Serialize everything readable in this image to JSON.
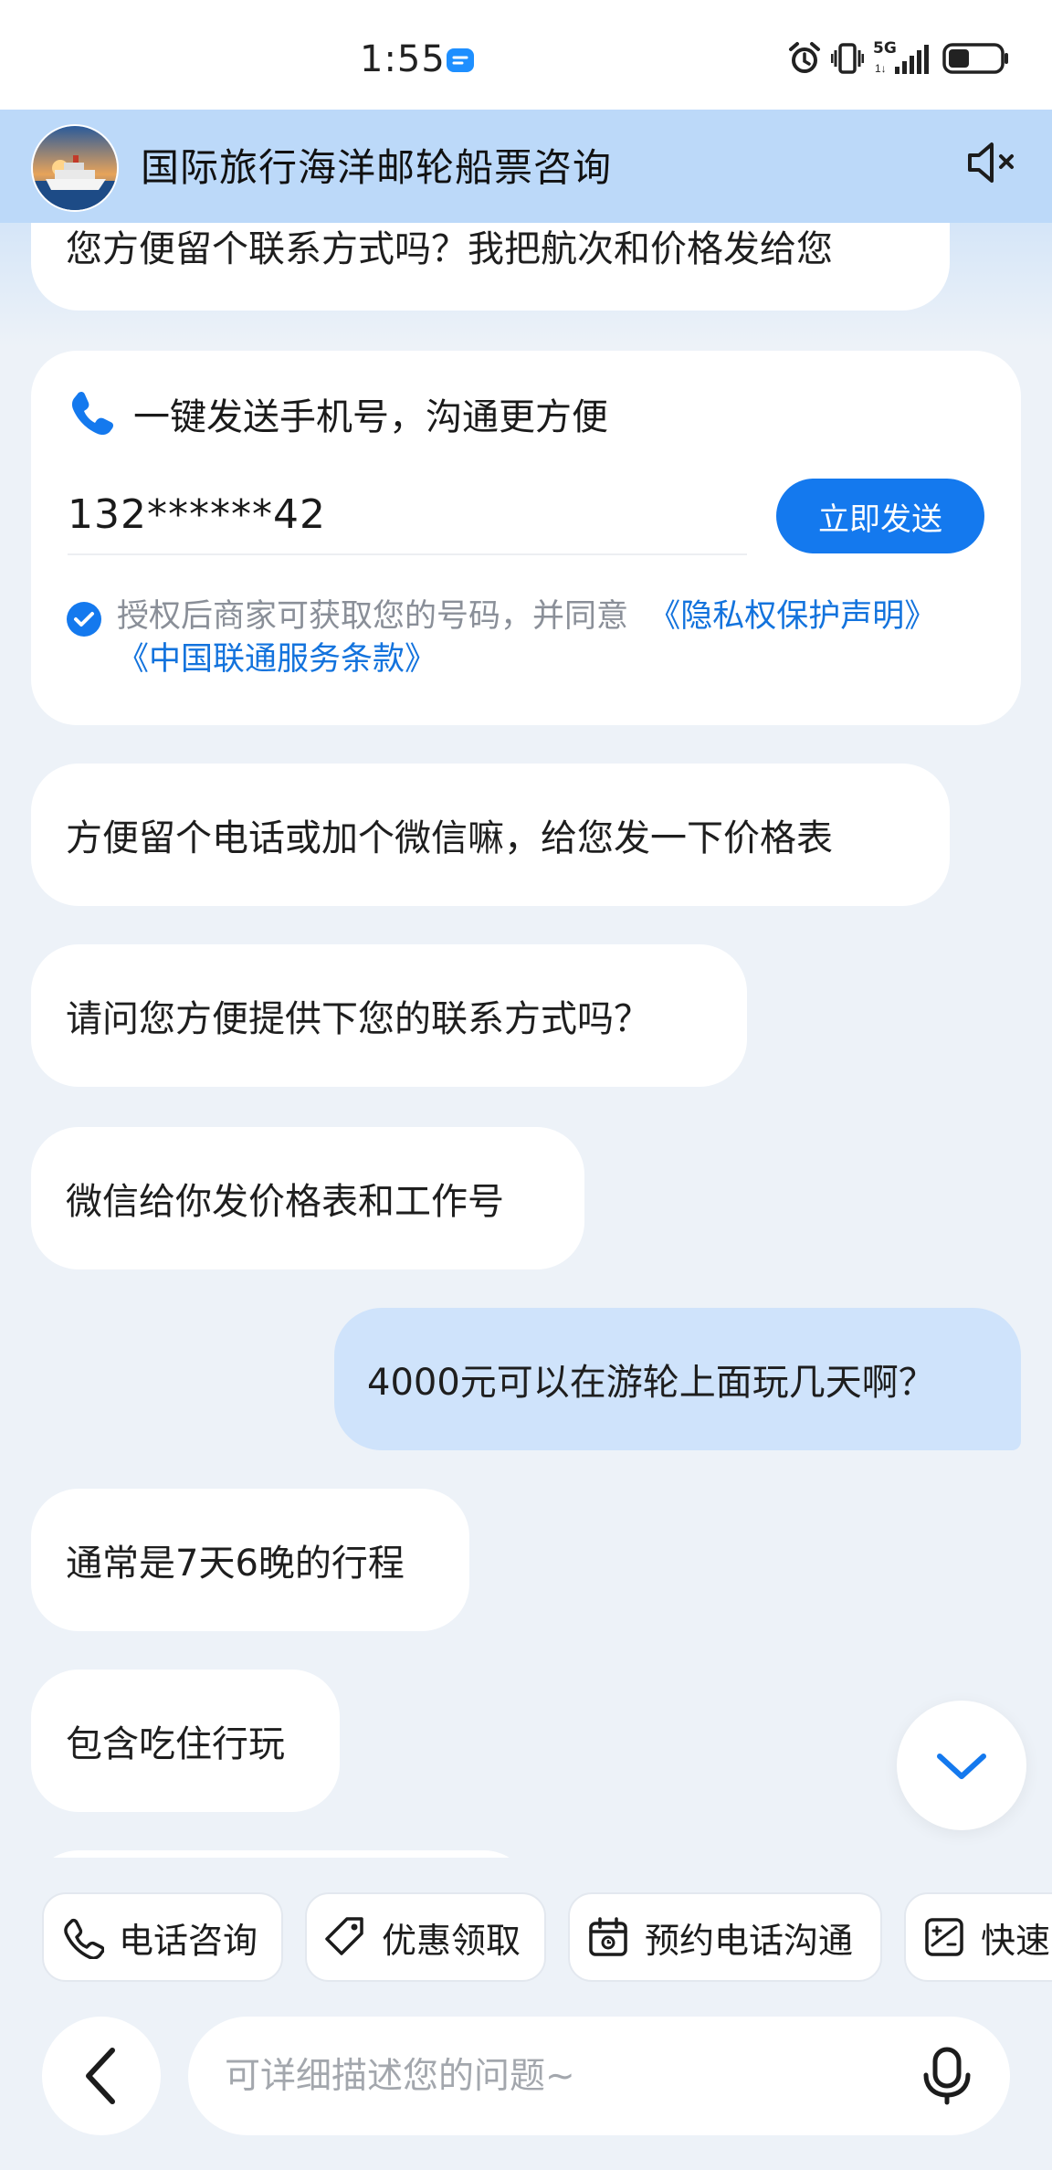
{
  "status_bar": {
    "time": "1:55",
    "network": "5G",
    "icons": [
      "chat-bubble-icon",
      "alarm-icon",
      "vibrate-icon",
      "signal-icon",
      "battery-icon"
    ]
  },
  "header": {
    "title": "国际旅行海洋邮轮船票咨询",
    "avatar": "cruise-ship-avatar",
    "mute_icon": "speaker-muted-icon"
  },
  "chat": {
    "top_bubble": "您方便留个联系方式吗？我把航次和价格发给您",
    "phone_card": {
      "title": "一键发送手机号，沟通更方便",
      "phone": "132******42",
      "send_label": "立即发送",
      "consent_text": "授权后商家可获取您的号码，并同意",
      "privacy_link": "《隐私权保护声明》",
      "terms_link": "《中国联通服务条款》"
    },
    "messages": [
      {
        "role": "agent",
        "text": "方便留个电话或加个微信嘛，给您发一下价格表"
      },
      {
        "role": "agent",
        "text": "请问您方便提供下您的联系方式吗？"
      },
      {
        "role": "agent",
        "text": "微信给你发价格表和工作号"
      },
      {
        "role": "user",
        "text": "4000元可以在游轮上面玩几天啊？"
      },
      {
        "role": "agent",
        "text": "通常是7天6晚的行程"
      },
      {
        "role": "agent",
        "text": "包含吃住行玩"
      }
    ]
  },
  "quick_actions": [
    {
      "label": "电话咨询",
      "icon": "phone-icon"
    },
    {
      "label": "优惠领取",
      "icon": "tag-icon"
    },
    {
      "label": "预约电话沟通",
      "icon": "calendar-icon"
    },
    {
      "label": "快速",
      "icon": "quick-calc-icon"
    }
  ],
  "input": {
    "placeholder": "可详细描述您的问题~"
  },
  "colors": {
    "accent": "#1479ee",
    "link": "#1373dd",
    "header_bg": "#bcd9f9",
    "user_bubble": "#cfe3fb",
    "page_bg": "#edf2f8"
  }
}
